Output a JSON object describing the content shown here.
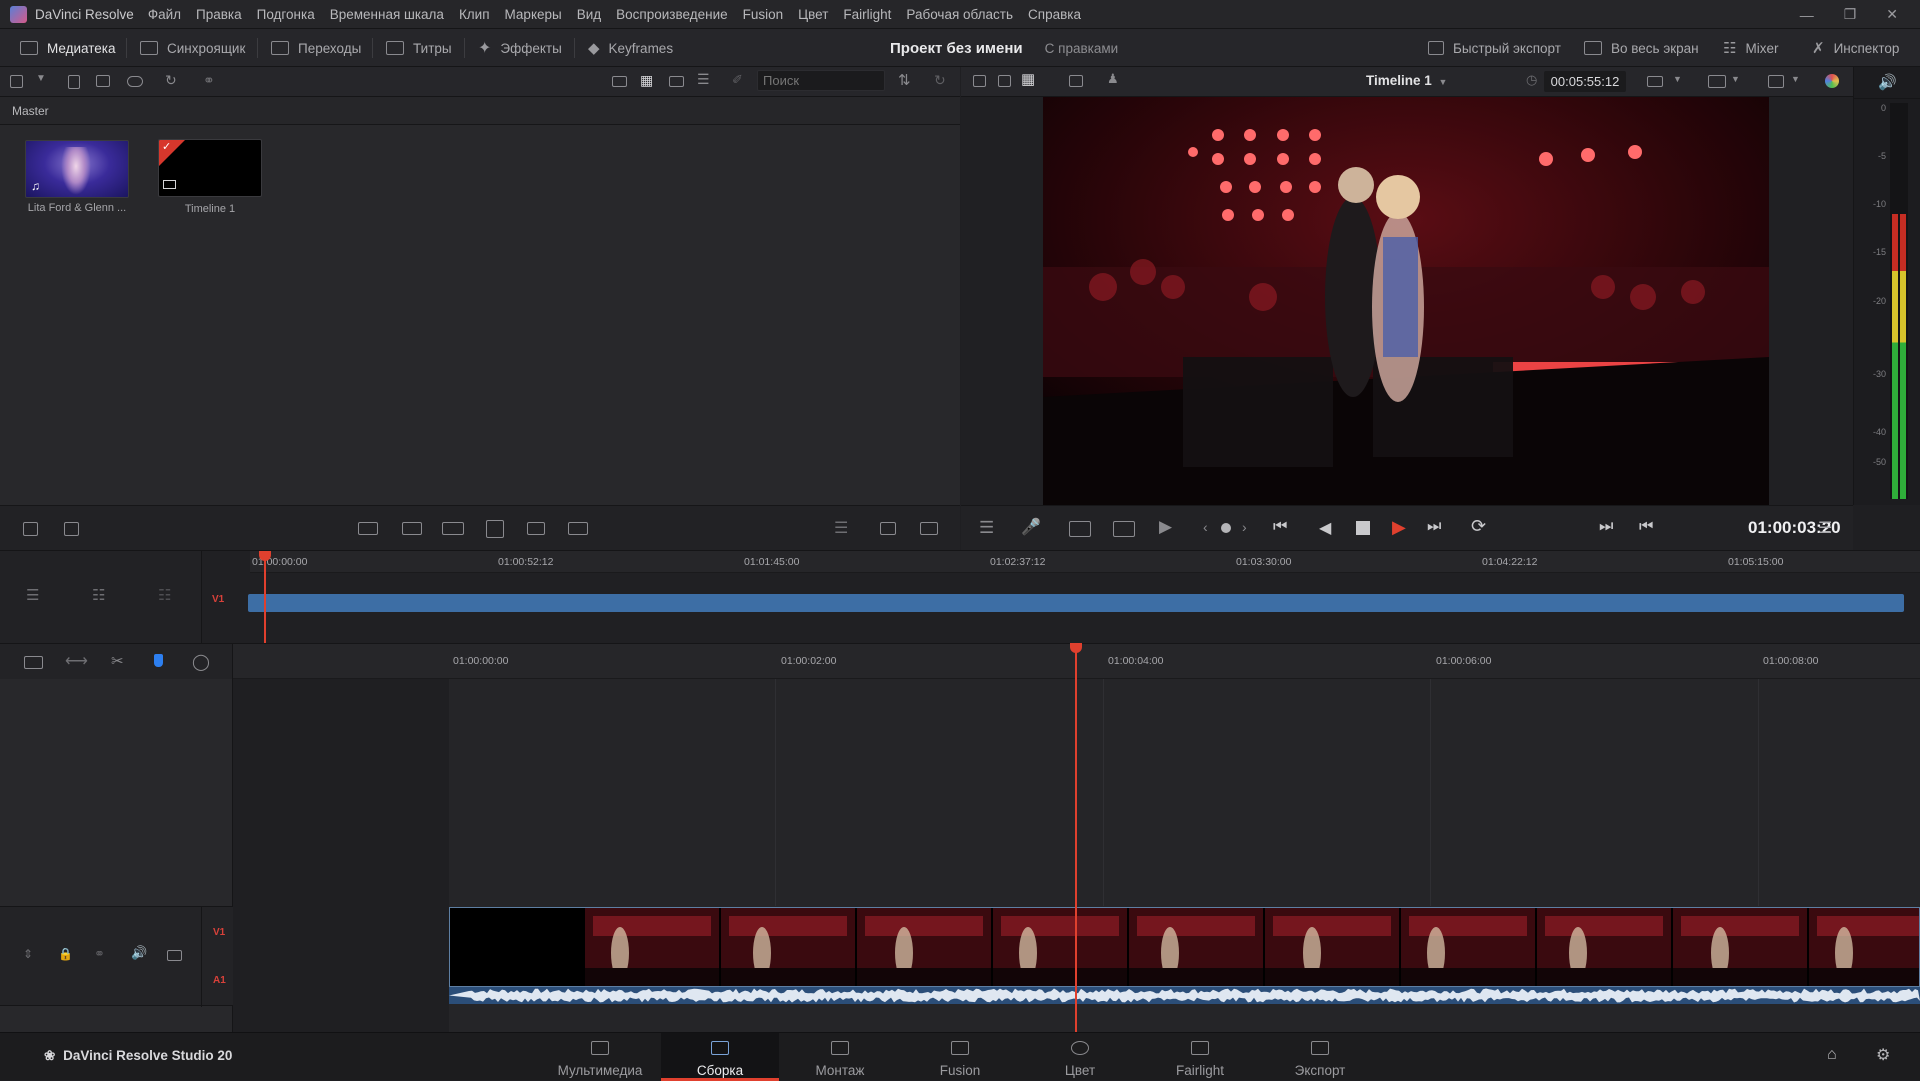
{
  "app": {
    "title": "DaVinci Resolve"
  },
  "menu": [
    "Файл",
    "Правка",
    "Подгонка",
    "Временная шкала",
    "Клип",
    "Маркеры",
    "Вид",
    "Воспроизведение",
    "Fusion",
    "Цвет",
    "Fairlight",
    "Рабочая область",
    "Справка"
  ],
  "modebar": {
    "left": [
      {
        "label": "Медиатека",
        "icon": "media-pool-icon",
        "active": true
      },
      {
        "label": "Синхроящик",
        "icon": "sync-bin-icon"
      },
      {
        "label": "Переходы",
        "icon": "transitions-icon"
      },
      {
        "label": "Титры",
        "icon": "titles-icon"
      },
      {
        "label": "Эффекты",
        "icon": "effects-icon"
      },
      {
        "label": "Keyframes",
        "icon": "keyframes-icon"
      }
    ],
    "right": [
      {
        "label": "Быстрый экспорт",
        "icon": "quick-export-icon"
      },
      {
        "label": "Во весь экран",
        "icon": "fullscreen-icon"
      },
      {
        "label": "Mixer",
        "icon": "mixer-icon"
      },
      {
        "label": "Инспектор",
        "icon": "inspector-icon"
      }
    ]
  },
  "project": {
    "name": "Проект без имени",
    "status": "С правками"
  },
  "mediapool": {
    "search_placeholder": "Поиск",
    "bin": "Master",
    "clips": [
      {
        "name": "Lita Ford & Glenn ...",
        "type": "audio-video"
      },
      {
        "name": "Timeline 1",
        "type": "timeline"
      }
    ]
  },
  "viewer": {
    "timeline_name": "Timeline 1",
    "duration": "00:05:55:12",
    "timecode": "01:00:03:20"
  },
  "audiometer": {
    "scale": [
      "0",
      "-5",
      "-10",
      "-15",
      "-20",
      "-30",
      "-40",
      "-50"
    ],
    "level": 0.72
  },
  "upper_timeline": {
    "ruler": [
      "01:00:00:00",
      "01:00:52:12",
      "01:01:45:00",
      "01:02:37:12",
      "01:03:30:00",
      "01:04:22:12",
      "01:05:15:00"
    ],
    "track": "V1"
  },
  "lower_timeline": {
    "ruler": [
      "01:00:00:00",
      "01:00:02:00",
      "01:00:04:00",
      "01:00:06:00",
      "01:00:08:00"
    ],
    "tracks": [
      "V1",
      "A1"
    ]
  },
  "pages": [
    {
      "label": "Мультимедиа",
      "icon": "media-page-icon"
    },
    {
      "label": "Сборка",
      "icon": "cut-page-icon",
      "active": true
    },
    {
      "label": "Монтаж",
      "icon": "edit-page-icon"
    },
    {
      "label": "Fusion",
      "icon": "fusion-page-icon"
    },
    {
      "label": "Цвет",
      "icon": "color-page-icon"
    },
    {
      "label": "Fairlight",
      "icon": "fairlight-page-icon"
    },
    {
      "label": "Экспорт",
      "icon": "deliver-page-icon"
    }
  ],
  "footer": {
    "product": "DaVinci Resolve Studio 20"
  },
  "colors": {
    "accent": "#e0402e",
    "clip_blue": "#3d6ea5",
    "playhead": "#e0402e"
  }
}
